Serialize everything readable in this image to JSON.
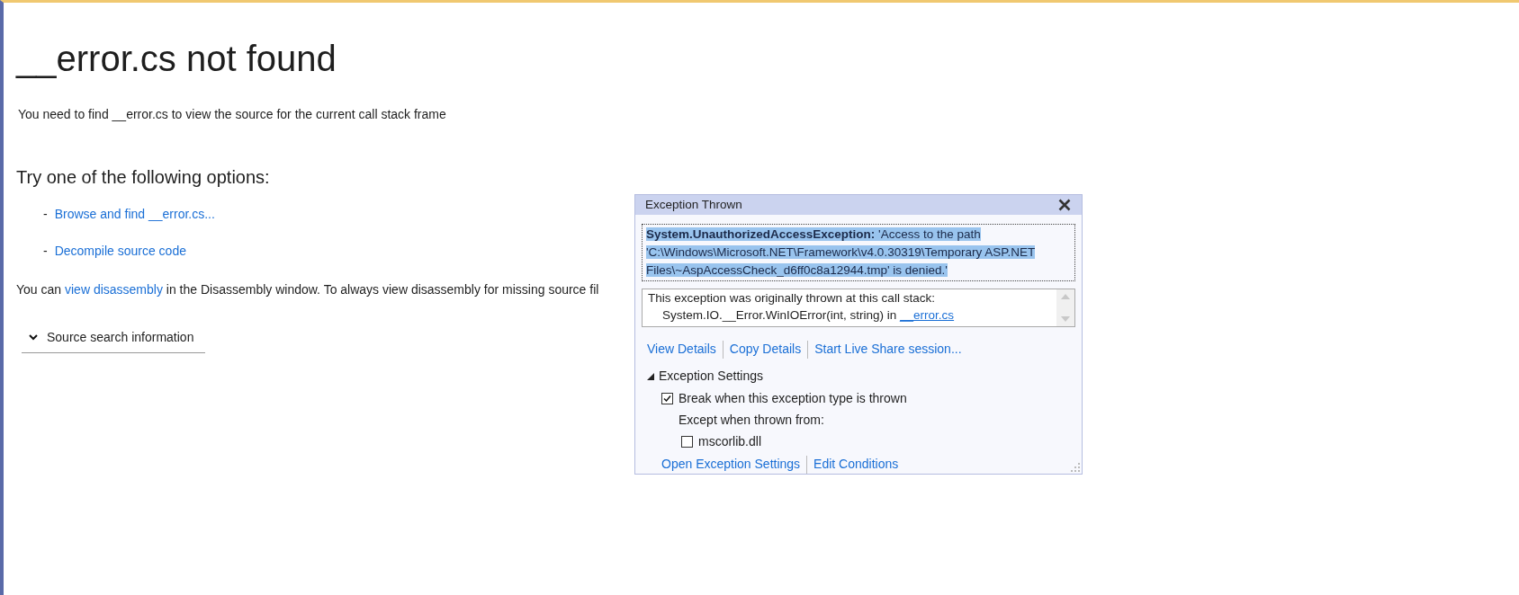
{
  "page": {
    "title": "__error.cs not found",
    "subtitle": "You need to find __error.cs to view the source for the current call stack frame",
    "options_heading": "Try one of the following options:",
    "options": [
      {
        "bullet": "-",
        "label": "Browse and find __error.cs..."
      },
      {
        "bullet": "-",
        "label": "Decompile source code"
      }
    ],
    "disassembly_note": {
      "before": "You can",
      "link": "view disassembly",
      "after": "in the Disassembly window. To always view disassembly for missing source fil"
    },
    "source_search": {
      "label": "Source search information",
      "expanded": false
    }
  },
  "popup": {
    "title": "Exception Thrown",
    "message": "**System.UnauthorizedAccessException:** 'Access to the path 'C:\\Windows\\Microsoft.NET\\Framework\\v4.0.30319\\Temporary ASP.NET Files\\~AspAccessCheck_d6ff0c8a12944.tmp' is denied.'",
    "stack_heading": "This exception was originally thrown at this call stack:",
    "stack_frame": "System.IO.__Error.WinIOError(int, string) in",
    "stack_link": "__error.cs",
    "actions": [
      "View Details",
      "Copy Details",
      "Start Live Share session..."
    ],
    "settings": {
      "label": "Exception Settings",
      "expanded": true,
      "break_label": "Break when this exception type is thrown",
      "break_checked": true,
      "except_label": "Except when thrown from:",
      "modules": [
        {
          "label": "mscorlib.dll",
          "checked": false
        }
      ]
    },
    "footer_links": [
      "Open Exception Settings",
      "Edit Conditions"
    ]
  }
}
